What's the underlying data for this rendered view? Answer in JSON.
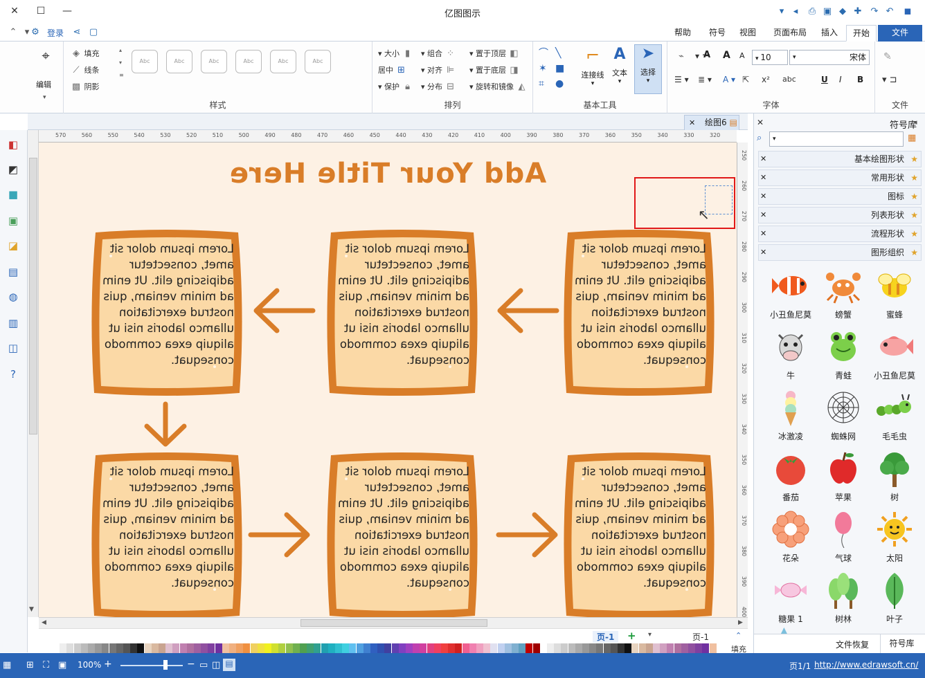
{
  "app": {
    "title": "亿图图示"
  },
  "tabs": [
    "文件",
    "开始",
    "插入",
    "页面布局",
    "视图",
    "符号",
    "帮助"
  ],
  "account": {
    "login_label": "登录"
  },
  "ribbon": {
    "file_group": {
      "label": "文件"
    },
    "font_group": {
      "label": "字体",
      "font_name": "宋体",
      "font_size": "10",
      "buttons": [
        "B",
        "I",
        "U",
        "abc"
      ]
    },
    "basic_tools_group": {
      "label": "基本工具",
      "select_label": "选择",
      "text_label": "文本",
      "connector_label": "连接线"
    },
    "arrange_group": {
      "label": "排列",
      "items": [
        "置于顶层",
        "置于底层",
        "旋转和镜像",
        "组合",
        "对齐",
        "分布",
        "大小",
        "居中",
        "保护"
      ]
    },
    "style_group": {
      "label": "样式",
      "swatch_label": "Abc",
      "items": [
        "填充",
        "线条",
        "阴影"
      ]
    },
    "edit_group": {
      "label": "编辑"
    }
  },
  "document_tab": {
    "label": "绘图6"
  },
  "diagram": {
    "title": "Add Your Title Here",
    "card_text": "Lorem ipsum dolor sit amet, consectetur adipiscing elit. Ut enim ad minim veniam, quis nostrud exercitation ullamco laboris nisi ut aliquip exea commodo consequat.",
    "color_accent": "#d97d28",
    "color_card_fill": "#fbd9a6",
    "color_background": "#fdf1e4"
  },
  "ruler": {
    "horizontal_labels": [
      "570",
      "560",
      "550",
      "540",
      "530",
      "520",
      "510",
      "500",
      "490",
      "480",
      "470",
      "460",
      "450",
      "440",
      "430",
      "420",
      "410",
      "400",
      "390",
      "380",
      "370",
      "360",
      "350",
      "340",
      "330",
      "320"
    ],
    "vertical_labels": [
      "250",
      "260",
      "270",
      "280",
      "290",
      "300",
      "310",
      "320",
      "330",
      "340",
      "350",
      "360",
      "370",
      "380",
      "390",
      "400"
    ]
  },
  "pagebar": {
    "page_name": "页-1",
    "page_tab": "页-1",
    "fill_label": "填充"
  },
  "symbol_library": {
    "header": "符号库",
    "search_placeholder": "",
    "categories": [
      "基本绘图形状",
      "常用形状",
      "图标",
      "列表形状",
      "流程形状",
      "图形组织"
    ],
    "symbols": [
      {
        "name": "蜜蜂",
        "icon": "bee-icon"
      },
      {
        "name": "螃蟹",
        "icon": "crab-icon"
      },
      {
        "name": "小丑鱼尼莫",
        "icon": "clownfish-icon"
      },
      {
        "name": "小丑鱼尼莫",
        "icon": "fish-icon"
      },
      {
        "name": "青蛙",
        "icon": "frog-icon"
      },
      {
        "name": "牛",
        "icon": "cow-icon"
      },
      {
        "name": "毛毛虫",
        "icon": "caterpillar-icon"
      },
      {
        "name": "蜘蛛网",
        "icon": "spiderweb-icon"
      },
      {
        "name": "冰激凌",
        "icon": "icecream-icon"
      },
      {
        "name": "树",
        "icon": "tree-icon"
      },
      {
        "name": "苹果",
        "icon": "apple-icon"
      },
      {
        "name": "番茄",
        "icon": "tomato-icon"
      },
      {
        "name": "太阳",
        "icon": "sun-icon"
      },
      {
        "name": "气球",
        "icon": "balloon-icon"
      },
      {
        "name": "花朵",
        "icon": "flower-icon"
      },
      {
        "name": "叶子",
        "icon": "leaf-icon"
      },
      {
        "name": "树林",
        "icon": "forest-icon"
      },
      {
        "name": "糖果 1",
        "icon": "candy-icon"
      }
    ],
    "bottom_tabs": [
      "符号库",
      "文件恢复"
    ]
  },
  "status": {
    "url": "http://www.edrawsoft.cn/",
    "page_info": "页1/1",
    "zoom": "100%"
  }
}
